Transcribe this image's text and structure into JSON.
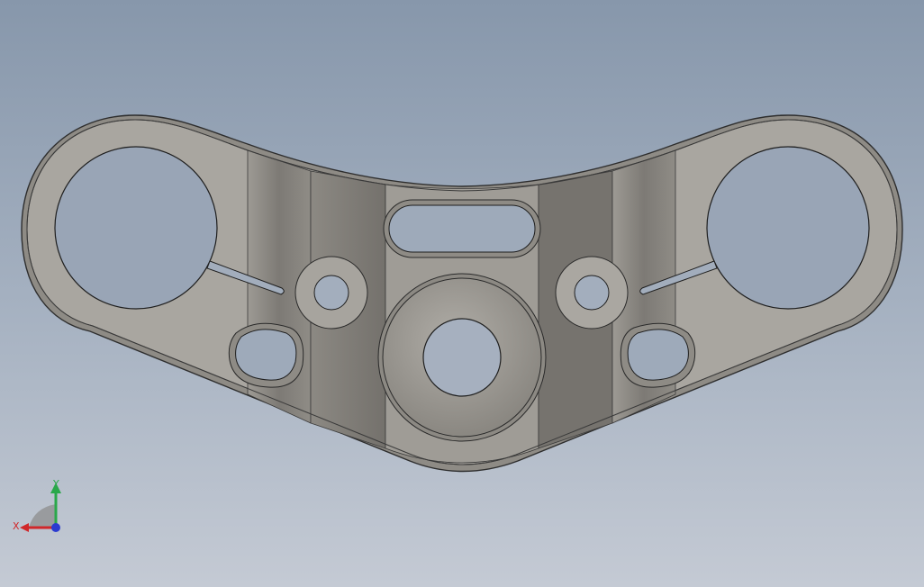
{
  "viewport": {
    "background_top": "#8797ab",
    "background_bottom": "#c4cad4"
  },
  "model": {
    "part": "triple-clamp-plate",
    "face_color": "#a9a6a0",
    "edge_color": "#3a3a3a",
    "shaded_band_color": "#7f7c77"
  },
  "triad": {
    "x_label": "X",
    "y_label": "Y",
    "x_color": "#d0272a",
    "y_color": "#2aa84a",
    "z_color": "#2b3bd0"
  }
}
